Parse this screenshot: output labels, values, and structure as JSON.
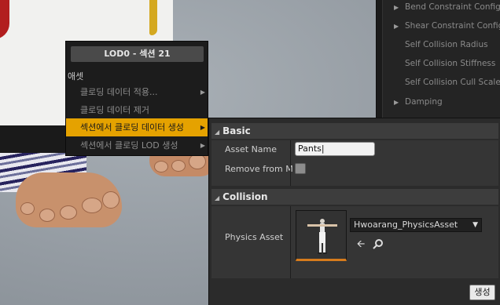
{
  "details_panel": {
    "rows": [
      {
        "label": "Bend Constraint Config",
        "expander": true
      },
      {
        "label": "Shear Constraint Config",
        "expander": true
      },
      {
        "label": "Self Collision Radius",
        "expander": false
      },
      {
        "label": "Self Collision Stiffness",
        "expander": false
      },
      {
        "label": "Self Collision Cull Scale",
        "expander": false
      },
      {
        "label": "Damping",
        "expander": true
      }
    ]
  },
  "context_menu": {
    "title": "LOD0 - 섹션 21",
    "section_header": "애셋",
    "items": [
      {
        "label": "클로딩 데이터 적용...",
        "has_submenu": true,
        "highlighted": false
      },
      {
        "label": "클로딩 데이터 제거",
        "has_submenu": false,
        "highlighted": false
      },
      {
        "label": "섹션에서 클로딩 데이터 생성",
        "has_submenu": true,
        "highlighted": true
      },
      {
        "label": "섹션에서 클로딩 LOD 생성",
        "has_submenu": true,
        "highlighted": false
      }
    ]
  },
  "dialog": {
    "basic": {
      "category": "Basic",
      "asset_name_label": "Asset Name",
      "asset_name_value": "Pants",
      "remove_from_mesh_label": "Remove from M",
      "remove_from_mesh_checked": false
    },
    "collision": {
      "category": "Collision",
      "physics_asset_label": "Physics Asset",
      "physics_asset_value": "Hwoarang_PhysicsAsset"
    },
    "create_button": "생성"
  },
  "icons": {
    "expand_arrow": "triangle-right-icon",
    "collapse_arrow": "triangle-down-icon",
    "browse_back": "arrow-left-icon",
    "find": "magnifier-icon"
  },
  "colors": {
    "highlight": "#e5a200",
    "thumbnail_underline": "#d67b1c"
  }
}
